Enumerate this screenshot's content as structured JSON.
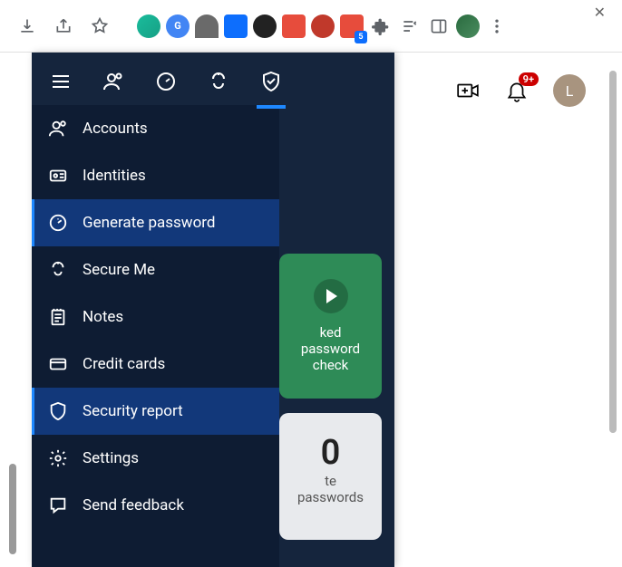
{
  "browser": {
    "extension_badge": "5"
  },
  "header": {
    "notification_count": "9+",
    "avatar_initial": "L"
  },
  "panel": {
    "menu": [
      {
        "key": "accounts",
        "label": "Accounts",
        "selected": false
      },
      {
        "key": "identities",
        "label": "Identities",
        "selected": false
      },
      {
        "key": "generate",
        "label": "Generate password",
        "selected": true
      },
      {
        "key": "secureme",
        "label": "Secure Me",
        "selected": false
      },
      {
        "key": "notes",
        "label": "Notes",
        "selected": false
      },
      {
        "key": "creditcards",
        "label": "Credit cards",
        "selected": false
      },
      {
        "key": "security",
        "label": "Security report",
        "selected": true
      },
      {
        "key": "settings",
        "label": "Settings",
        "selected": false
      },
      {
        "key": "feedback",
        "label": "Send feedback",
        "selected": false
      }
    ],
    "cards": {
      "green_line1": "ked password",
      "green_line2": "check",
      "grey_number": "0",
      "grey_text": "te passwords"
    }
  }
}
